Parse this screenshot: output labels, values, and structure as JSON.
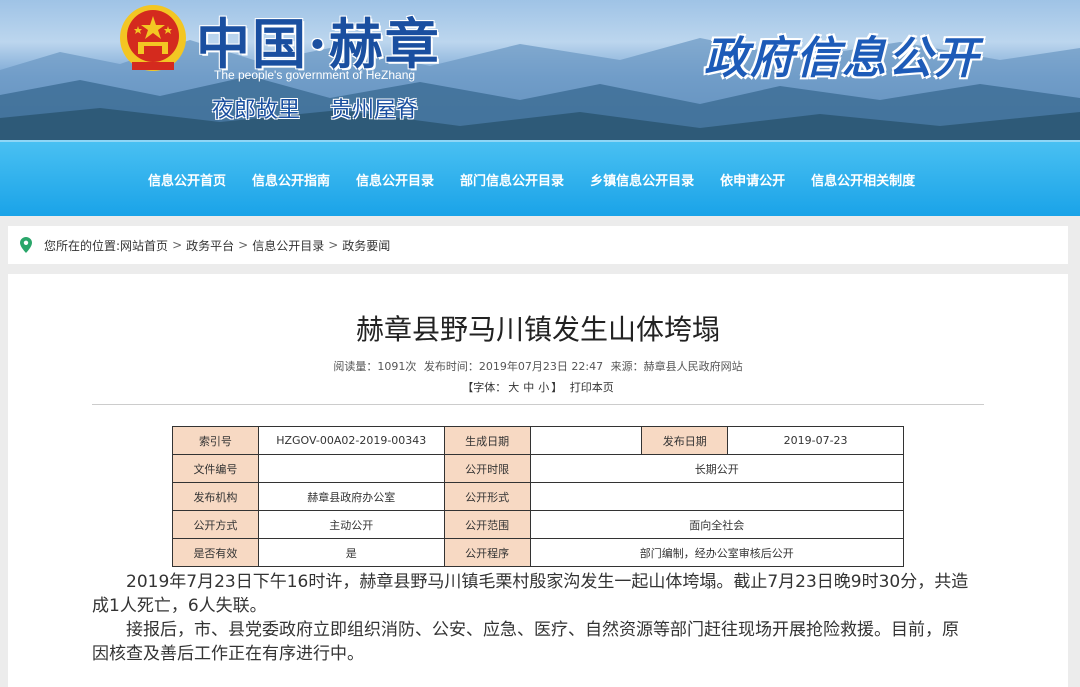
{
  "header": {
    "site_title": "中国·赫章",
    "site_subtitle_en": "The people's government of HeZhang",
    "slogans": [
      "夜郎故里",
      "贵州屋脊"
    ],
    "section_title": "政府信息公开"
  },
  "nav": {
    "items": [
      "信息公开首页",
      "信息公开指南",
      "信息公开目录",
      "部门信息公开目录",
      "乡镇信息公开目录",
      "依申请公开",
      "信息公开相关制度"
    ]
  },
  "breadcrumb": {
    "label": "您所在的位置:",
    "items": [
      "网站首页",
      "政务平台",
      "信息公开目录",
      "政务要闻"
    ],
    "separator": ">"
  },
  "article": {
    "title": "赫章县野马川镇发生山体垮塌",
    "reads": "阅读量：1091次",
    "published": "发布时间：2019年07月23日 22:47",
    "source": "来源：赫章县人民政府网站",
    "font_label_open": "【字体：",
    "font_large": "大",
    "font_medium": "中",
    "font_small": "小",
    "font_label_close": "】",
    "print": "打印本页",
    "paragraphs": [
      "2019年7月23日下午16时许，赫章县野马川镇毛栗村殷家沟发生一起山体垮塌。截止7月23日晚9时30分，共造成1人死亡，6人失联。",
      "接报后，市、县党委政府立即组织消防、公安、应急、医疗、自然资源等部门赶往现场开展抢险救援。目前，原因核查及善后工作正在有序进行中。"
    ]
  },
  "info_table": {
    "index_label": "索引号",
    "index_value": "HZGOV-00A02-2019-00343",
    "gen_date_label": "生成日期",
    "gen_date_value": "",
    "pub_date_label": "发布日期",
    "pub_date_value": "2019-07-23",
    "doc_no_label": "文件编号",
    "doc_no_value": "",
    "period_label": "公开时限",
    "period_value": "长期公开",
    "org_label": "发布机构",
    "org_value": "赫章县政府办公室",
    "form_label": "公开形式",
    "form_value": "",
    "method_label": "公开方式",
    "method_value": "主动公开",
    "scope_label": "公开范围",
    "scope_value": "面向全社会",
    "valid_label": "是否有效",
    "valid_value": "是",
    "proc_label": "公开程序",
    "proc_value": "部门编制，经办公室审核后公开"
  },
  "colors": {
    "nav_bg": "#1aa3e8",
    "title_blue": "#1a4fa0",
    "table_key_bg": "#f7d9c3",
    "emblem_red": "#d42a1e",
    "emblem_gold": "#f3c623"
  },
  "icons": {
    "breadcrumb": "location-pin-icon",
    "emblem": "national-emblem-icon"
  }
}
